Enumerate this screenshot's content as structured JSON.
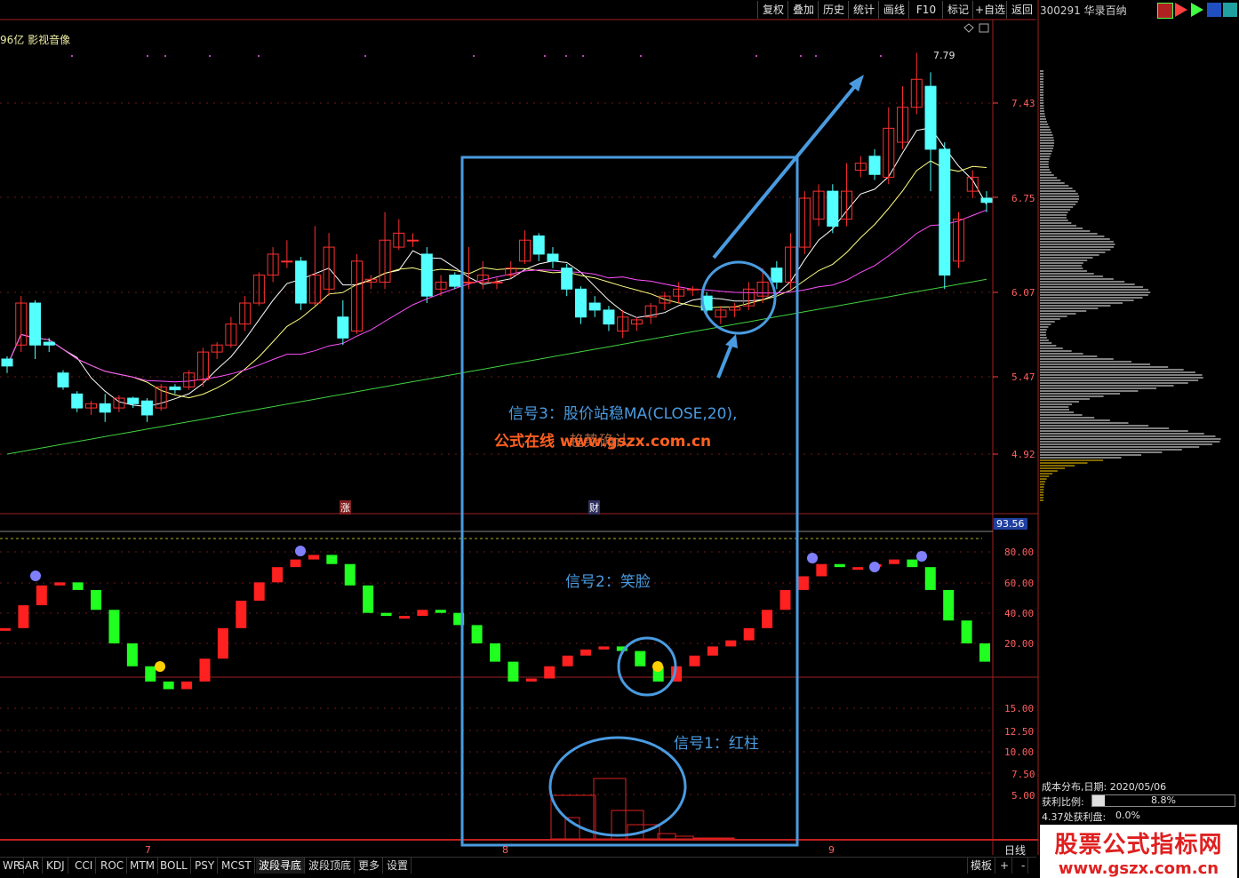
{
  "colors": {
    "up": "#ff3030",
    "down": "#54ffff",
    "ma5": "#ffffff",
    "ma10": "#ffff80",
    "ma20": "#ff50ff",
    "ma60": "#40d040",
    "annotation": "#4a9be0",
    "osc_up": "#ff2020",
    "osc_down": "#20ff20"
  },
  "toolbar": {
    "buttons": [
      "复权",
      "叠加",
      "历史",
      "统计",
      "画线",
      "F10",
      "标记",
      "+自选",
      "返回"
    ]
  },
  "stock": {
    "code_name": "300291 华录百纳",
    "header_fragment": "96亿 影视音像"
  },
  "main_chart": {
    "price_labels": [
      "7.43",
      "6.75",
      "6.07",
      "5.47",
      "4.92"
    ],
    "high_mark": "7.79",
    "event_marks": [
      "涨",
      "财"
    ]
  },
  "osc_chart": {
    "value_box": "93.56",
    "labels": [
      "80.00",
      "60.00",
      "40.00",
      "20.00"
    ]
  },
  "vol_chart": {
    "labels": [
      "15.00",
      "12.50",
      "10.00",
      "7.50",
      "5.00"
    ]
  },
  "x_axis": {
    "months": [
      "7",
      "8",
      "9"
    ],
    "period": "日线"
  },
  "annotations": {
    "signal3_line1": "信号3：股价站稳MA(CLOSE,20),",
    "signal3_line2": "趋势确认",
    "watermark": "公式在线 www.gszx.com.cn",
    "signal2": "信号2：笑脸",
    "signal1": "信号1：红柱"
  },
  "cost_distribution": {
    "title": "成本分布,日期: 2020/05/06",
    "profit_ratio_label": "获利比例:",
    "profit_ratio_value": "8.8%",
    "profit_ratio": 0.088,
    "profit_at_label": "4.37处获利盘:",
    "profit_at_value": "0.0%"
  },
  "bottom_tabs": [
    "WR",
    "SAR",
    "KDJ",
    "CCI",
    "ROC",
    "MTM",
    "BOLL",
    "PSY",
    "MCST",
    "波段寻底",
    "波段顶底",
    "更多",
    "设置"
  ],
  "bottom_right": [
    "模板",
    "+",
    "-"
  ],
  "logo": {
    "line1": "股票公式指标网",
    "line2": "www.gszx.com.cn"
  },
  "chart_data": {
    "type": "candlestick",
    "y_range": [
      4.5,
      7.9
    ],
    "candles": [
      [
        5.6,
        5.55,
        5.5,
        5.62
      ],
      [
        5.7,
        6.0,
        5.65,
        6.05
      ],
      [
        6.0,
        5.7,
        5.6,
        6.02
      ],
      [
        5.72,
        5.7,
        5.65,
        5.75
      ],
      [
        5.5,
        5.4,
        5.38,
        5.52
      ],
      [
        5.35,
        5.25,
        5.22,
        5.37
      ],
      [
        5.25,
        5.28,
        5.2,
        5.3
      ],
      [
        5.28,
        5.22,
        5.15,
        5.35
      ],
      [
        5.25,
        5.32,
        5.22,
        5.34
      ],
      [
        5.32,
        5.28,
        5.25,
        5.33
      ],
      [
        5.3,
        5.2,
        5.15,
        5.32
      ],
      [
        5.25,
        5.4,
        5.23,
        5.42
      ],
      [
        5.4,
        5.38,
        5.35,
        5.42
      ],
      [
        5.4,
        5.5,
        5.38,
        5.52
      ],
      [
        5.45,
        5.65,
        5.4,
        5.68
      ],
      [
        5.65,
        5.7,
        5.6,
        5.72
      ],
      [
        5.7,
        5.85,
        5.68,
        5.9
      ],
      [
        5.85,
        6.0,
        5.8,
        6.05
      ],
      [
        6.0,
        6.2,
        5.98,
        6.22
      ],
      [
        6.2,
        6.35,
        6.15,
        6.4
      ],
      [
        6.3,
        6.3,
        6.25,
        6.45
      ],
      [
        6.3,
        6.0,
        5.95,
        6.33
      ],
      [
        6.0,
        6.2,
        5.98,
        6.55
      ],
      [
        6.1,
        6.4,
        6.05,
        6.5
      ],
      [
        5.9,
        5.75,
        5.7,
        6.02
      ],
      [
        5.8,
        6.3,
        5.78,
        6.35
      ],
      [
        6.15,
        6.17,
        6.1,
        6.2
      ],
      [
        6.15,
        6.45,
        6.1,
        6.65
      ],
      [
        6.4,
        6.5,
        6.38,
        6.6
      ],
      [
        6.45,
        6.45,
        6.4,
        6.5
      ],
      [
        6.35,
        6.05,
        6.0,
        6.4
      ],
      [
        6.1,
        6.15,
        6.05,
        6.2
      ],
      [
        6.2,
        6.12,
        6.1,
        6.22
      ],
      [
        6.15,
        6.15,
        6.1,
        6.4
      ],
      [
        6.15,
        6.2,
        6.1,
        6.3
      ],
      [
        6.15,
        6.15,
        6.1,
        6.18
      ],
      [
        6.2,
        6.25,
        6.18,
        6.3
      ],
      [
        6.3,
        6.45,
        6.28,
        6.52
      ],
      [
        6.48,
        6.35,
        6.3,
        6.5
      ],
      [
        6.35,
        6.3,
        6.25,
        6.4
      ],
      [
        6.25,
        6.1,
        6.05,
        6.28
      ],
      [
        6.1,
        5.9,
        5.85,
        6.12
      ],
      [
        6.0,
        5.95,
        5.9,
        6.05
      ],
      [
        5.95,
        5.85,
        5.8,
        5.98
      ],
      [
        5.8,
        5.9,
        5.75,
        5.95
      ],
      [
        5.85,
        5.88,
        5.8,
        5.9
      ],
      [
        5.9,
        5.98,
        5.85,
        6.0
      ],
      [
        6.0,
        6.05,
        5.95,
        6.08
      ],
      [
        6.05,
        6.1,
        6.0,
        6.15
      ],
      [
        6.1,
        6.1,
        6.05,
        6.12
      ],
      [
        6.05,
        5.95,
        5.9,
        6.08
      ],
      [
        5.9,
        5.95,
        5.85,
        5.98
      ],
      [
        5.95,
        5.97,
        5.9,
        6.0
      ],
      [
        5.98,
        6.1,
        5.95,
        6.15
      ],
      [
        6.05,
        6.15,
        6.0,
        6.25
      ],
      [
        6.25,
        6.15,
        6.1,
        6.3
      ],
      [
        6.15,
        6.4,
        6.1,
        6.5
      ],
      [
        6.4,
        6.75,
        6.35,
        6.8
      ],
      [
        6.6,
        6.8,
        6.55,
        6.85
      ],
      [
        6.8,
        6.55,
        6.5,
        6.85
      ],
      [
        6.6,
        6.8,
        6.55,
        7.0
      ],
      [
        6.95,
        7.0,
        6.9,
        7.05
      ],
      [
        7.05,
        6.92,
        6.88,
        7.1
      ],
      [
        6.9,
        7.25,
        6.85,
        7.4
      ],
      [
        7.15,
        7.4,
        7.1,
        7.55
      ],
      [
        7.4,
        7.6,
        7.35,
        7.79
      ],
      [
        7.55,
        7.1,
        6.8,
        7.65
      ],
      [
        7.1,
        6.2,
        6.1,
        7.15
      ],
      [
        6.3,
        6.6,
        6.25,
        6.65
      ],
      [
        6.8,
        6.9,
        6.75,
        6.95
      ],
      [
        6.75,
        6.72,
        6.65,
        6.8
      ]
    ],
    "osc_values": [
      30,
      45,
      58,
      60,
      55,
      42,
      20,
      5,
      -5,
      -10,
      -5,
      10,
      30,
      48,
      60,
      70,
      75,
      78,
      72,
      58,
      40,
      38,
      38,
      42,
      40,
      32,
      20,
      8,
      -5,
      -3,
      5,
      12,
      16,
      18,
      15,
      5,
      -5,
      5,
      12,
      18,
      22,
      30,
      42,
      55,
      64,
      72,
      70,
      70,
      72,
      75,
      70,
      55,
      35,
      20,
      8
    ],
    "cost_region_top": 4.5,
    "vol_bars": [
      [
        0.47,
        0.2
      ],
      [
        0.49,
        0.15
      ],
      [
        0.52,
        0.27
      ],
      [
        0.55,
        0.17
      ],
      [
        0.58,
        0.09
      ],
      [
        0.61,
        0.02
      ],
      [
        0.63,
        0.01
      ]
    ]
  }
}
